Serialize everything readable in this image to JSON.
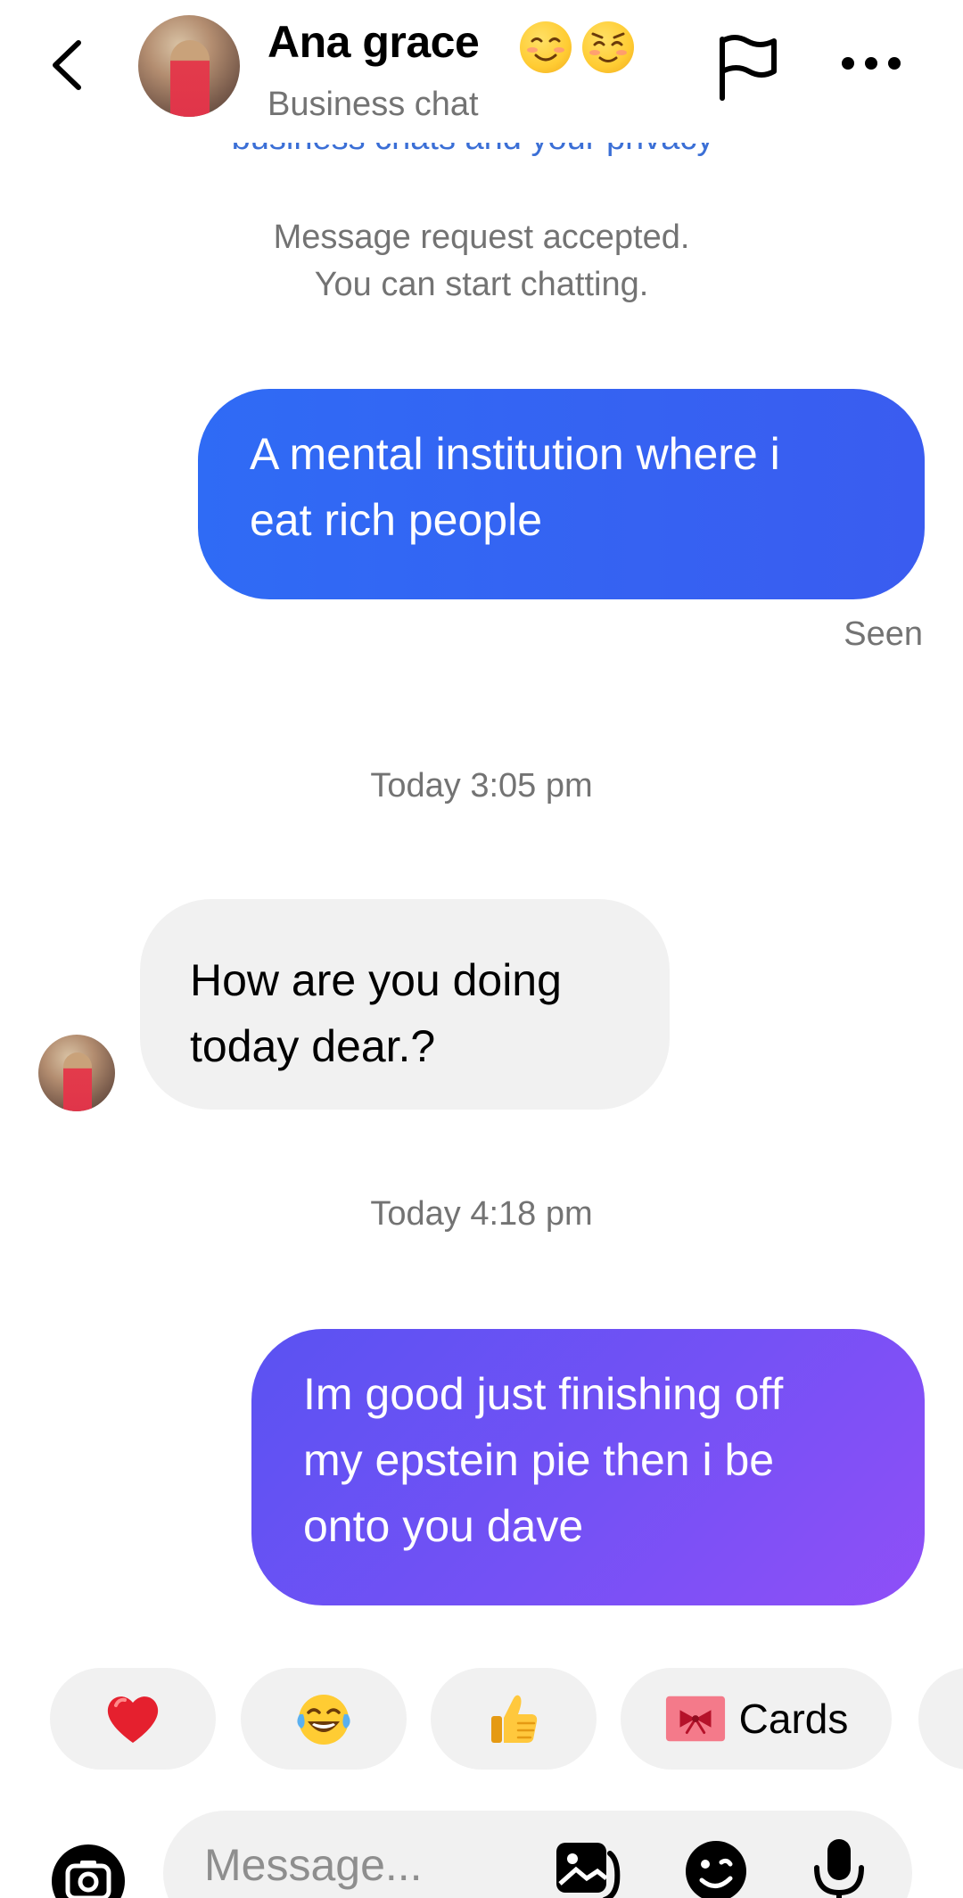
{
  "header": {
    "contact_name": "Ana grace",
    "subtitle": "Business chat",
    "name_emojis": [
      "smiling-face-icon",
      "relieved-face-icon"
    ]
  },
  "notice": {
    "clipped_text": "business chats and your privacy"
  },
  "system_message": {
    "line1": "Message request accepted.",
    "line2": "You can start chatting."
  },
  "messages": [
    {
      "direction": "outgoing",
      "lines": [
        "A mental institution where i",
        "eat rich people"
      ],
      "status": "Seen"
    },
    {
      "timestamp": "Today 3:05 pm"
    },
    {
      "direction": "incoming",
      "lines": [
        "How are you doing",
        "today dear.?"
      ]
    },
    {
      "timestamp": "Today 4:18 pm"
    },
    {
      "direction": "outgoing",
      "lines": [
        "Im good just finishing off",
        "my epstein pie then i be",
        "onto you dave"
      ]
    }
  ],
  "reactions": {
    "items": [
      "heart-icon",
      "laughing-tears-icon",
      "thumbs-up-icon"
    ],
    "cards_label": "Cards"
  },
  "composer": {
    "placeholder": "Message..."
  },
  "colors": {
    "outgoing_blue": "#2f6bf5",
    "outgoing_purple": "#7551f5",
    "incoming_bg": "#f1f1f1",
    "meta_gray": "#737373"
  }
}
